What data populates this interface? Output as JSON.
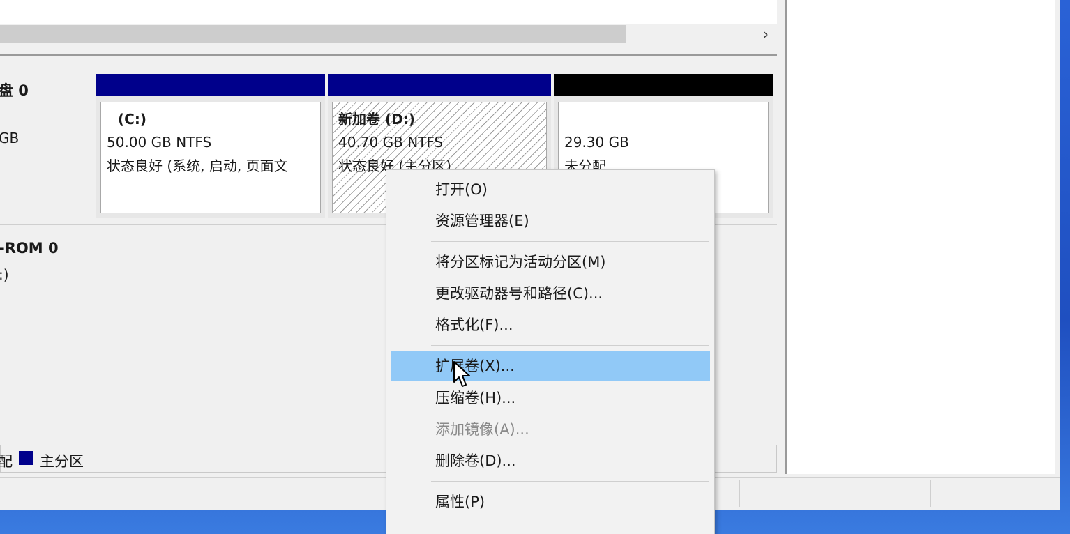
{
  "disks": [
    {
      "title": "盘 0",
      "sub": "GB",
      "partitions": [
        {
          "name": "(C:)",
          "size": "50.00 GB NTFS",
          "status": "状态良好 (系统, 启动, 页面文",
          "bar_color": "#00008b"
        },
        {
          "name": "新加卷  (D:)",
          "size": "40.70 GB NTFS",
          "status": "状态良好 (主分区)",
          "bar_color": "#00008b"
        },
        {
          "name": "",
          "size": "29.30 GB",
          "status": "未分配",
          "bar_color": "#000000"
        }
      ]
    },
    {
      "title": "-ROM 0",
      "sub": ":)"
    }
  ],
  "legend": {
    "item1": "配",
    "item2": "主分区",
    "primary_color": "#00008b"
  },
  "scroll": {
    "arrow": "›"
  },
  "context_menu": {
    "items": [
      {
        "label": "打开(O)"
      },
      {
        "label": "资源管理器(E)"
      },
      {
        "label": "将分区标记为活动分区(M)"
      },
      {
        "label": "更改驱动器号和路径(C)..."
      },
      {
        "label": "格式化(F)..."
      },
      {
        "label": "扩展卷(X)..."
      },
      {
        "label": "压缩卷(H)..."
      },
      {
        "label": "添加镜像(A)..."
      },
      {
        "label": "删除卷(D)..."
      },
      {
        "label": "属性(P)"
      }
    ],
    "highlighted": "扩展卷(X)...",
    "hover_color": "#91c9f7"
  }
}
